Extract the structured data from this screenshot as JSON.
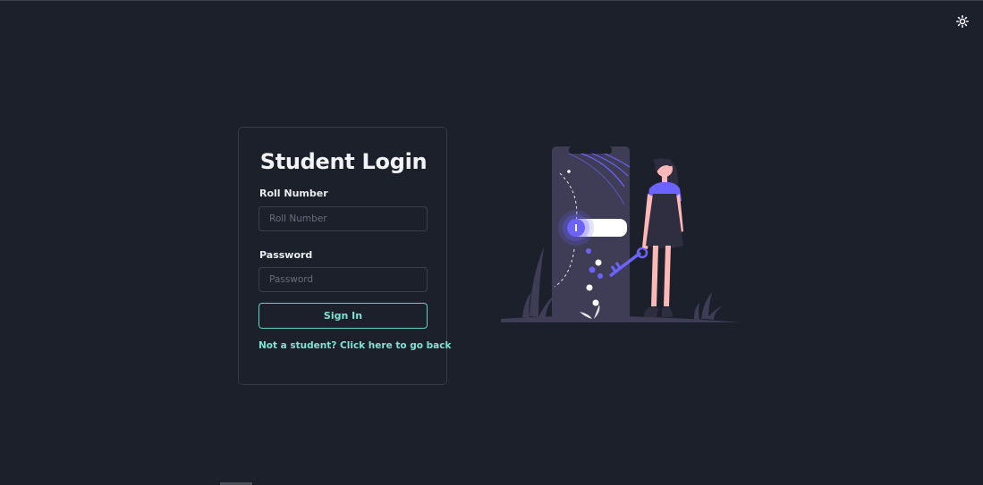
{
  "header": {
    "theme_toggle_icon": "sun-icon"
  },
  "login": {
    "title": "Student Login",
    "roll_number": {
      "label": "Roll Number",
      "placeholder": "Roll Number",
      "value": ""
    },
    "password": {
      "label": "Password",
      "placeholder": "Password",
      "value": ""
    },
    "submit_label": "Sign In",
    "back_link_label": "Not a student? Click here to go back"
  },
  "illustration": {
    "icon": "phone-unlock-illustration"
  },
  "colors": {
    "background": "#1b202b",
    "accent": "#7fe3d4",
    "illustration_primary": "#6c63ff",
    "card_border": "#343a46"
  }
}
